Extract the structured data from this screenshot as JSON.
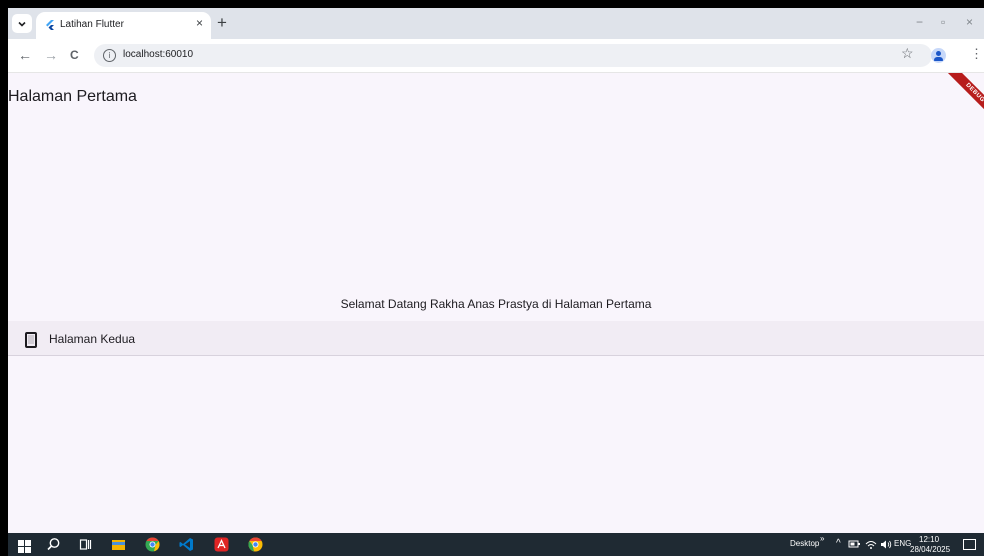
{
  "browser": {
    "tab_title": "Latihan Flutter",
    "tab_close": "×",
    "new_tab": "+",
    "window_minimize": "−",
    "window_restore": "▫",
    "window_close": "×",
    "back": "←",
    "forward": "→",
    "reload": "C",
    "url": "localhost:60010",
    "star": "☆",
    "menu": "⋮"
  },
  "app": {
    "title": "Halaman Pertama",
    "welcome": "Selamat Datang Rakha Anas Prastya di Halaman Pertama",
    "nav_tile_label": "Halaman Kedua",
    "debug_label": "DEBUG"
  },
  "taskbar": {
    "desktop_label": "Desktop",
    "chevron": "»",
    "caret": "^",
    "language": "ENG",
    "time": "12:10",
    "date": "28/04/2025"
  },
  "colors": {
    "app_background": "#f9f5fc",
    "tile_background": "#f1ecf4",
    "debug_banner": "#b71c1c",
    "taskbar": "#1f2a33"
  }
}
